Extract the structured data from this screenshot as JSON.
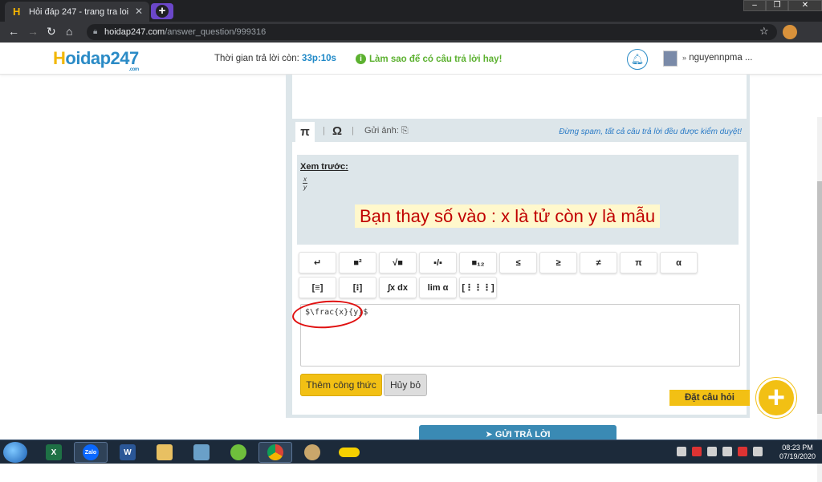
{
  "browser": {
    "tab_title": "Hỏi đáp 247 - trang tra loi",
    "url_host": "hoidap247.com",
    "url_path": "/answer_question/999316"
  },
  "header": {
    "logo_h": "H",
    "logo_rest": "oidap247",
    "logo_com": ".com",
    "timer_label": "Thời gian trả lời còn: ",
    "timer_value": "33p:10s",
    "howto": "Làm sao để có câu trả lời hay!",
    "username": "nguyennpma ..."
  },
  "editor": {
    "send_image": "Gửi ảnh:",
    "notice": "Đừng spam, tất cả câu trả lời đều được kiểm duyệt!",
    "preview_label": "Xem trước:",
    "preview_num": "x",
    "preview_den": "y",
    "hint": "Bạn thay số vào : x là tử còn y là mẫu",
    "latex": "$\\frac{x}{y}$",
    "add_formula": "Thêm công thức",
    "cancel": "Hủy bỏ",
    "row1": [
      "↵",
      "■²",
      "√■",
      "▪/▪",
      "■₁₂",
      "≤",
      "≥",
      "≠",
      "π",
      "α"
    ],
    "row2": [
      "[≡]",
      "[⁝]",
      "∫x dx",
      "lim α",
      "[⋮⋮⋮]"
    ]
  },
  "actions": {
    "ask": "Đặt câu hỏi",
    "plus": "+",
    "submit": "GỬI TRẢ LỜI"
  },
  "taskbar": {
    "time": "08:23 PM",
    "date": "07/19/2020"
  }
}
